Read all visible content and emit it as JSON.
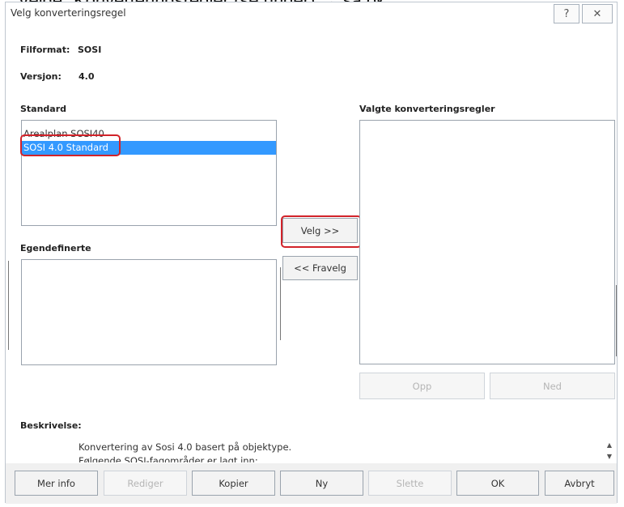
{
  "caption": "Velge \"Konverteringsregler (se under) → så ok.",
  "dialog": {
    "title": "Velg konverteringsregel",
    "help_icon": "help-icon",
    "close_icon": "close-icon",
    "help_glyph": "?",
    "close_glyph": "✕"
  },
  "fileinfo": {
    "filformat_label": "Filformat:",
    "filformat_value": "SOSI",
    "versjon_label": "Versjon:",
    "versjon_value": "4.0"
  },
  "standard": {
    "label": "Standard",
    "items": [
      {
        "label": "Arealplan SOSI40",
        "selected": false
      },
      {
        "label": "SOSI 4.0 Standard",
        "selected": true
      }
    ]
  },
  "egendefinerte": {
    "label": "Egendefinerte"
  },
  "valgte": {
    "label": "Valgte konverteringsregler"
  },
  "transfer": {
    "velg": "Velg >>",
    "fravelg": "<< Fravelg"
  },
  "order": {
    "opp": "Opp",
    "ned": "Ned"
  },
  "description": {
    "label": "Beskrivelse:",
    "line1": "Konvertering av Sosi 4.0 basert på objektype.",
    "line2": "Følgende SOSI-fagområder er lagt inn:"
  },
  "footer": {
    "mer_info": "Mer info",
    "rediger": "Rediger",
    "kopier": "Kopier",
    "ny": "Ny",
    "slette": "Slette",
    "ok": "OK",
    "avbryt": "Avbryt"
  },
  "colors": {
    "selection": "#3399ff",
    "highlight": "#d2232a"
  }
}
